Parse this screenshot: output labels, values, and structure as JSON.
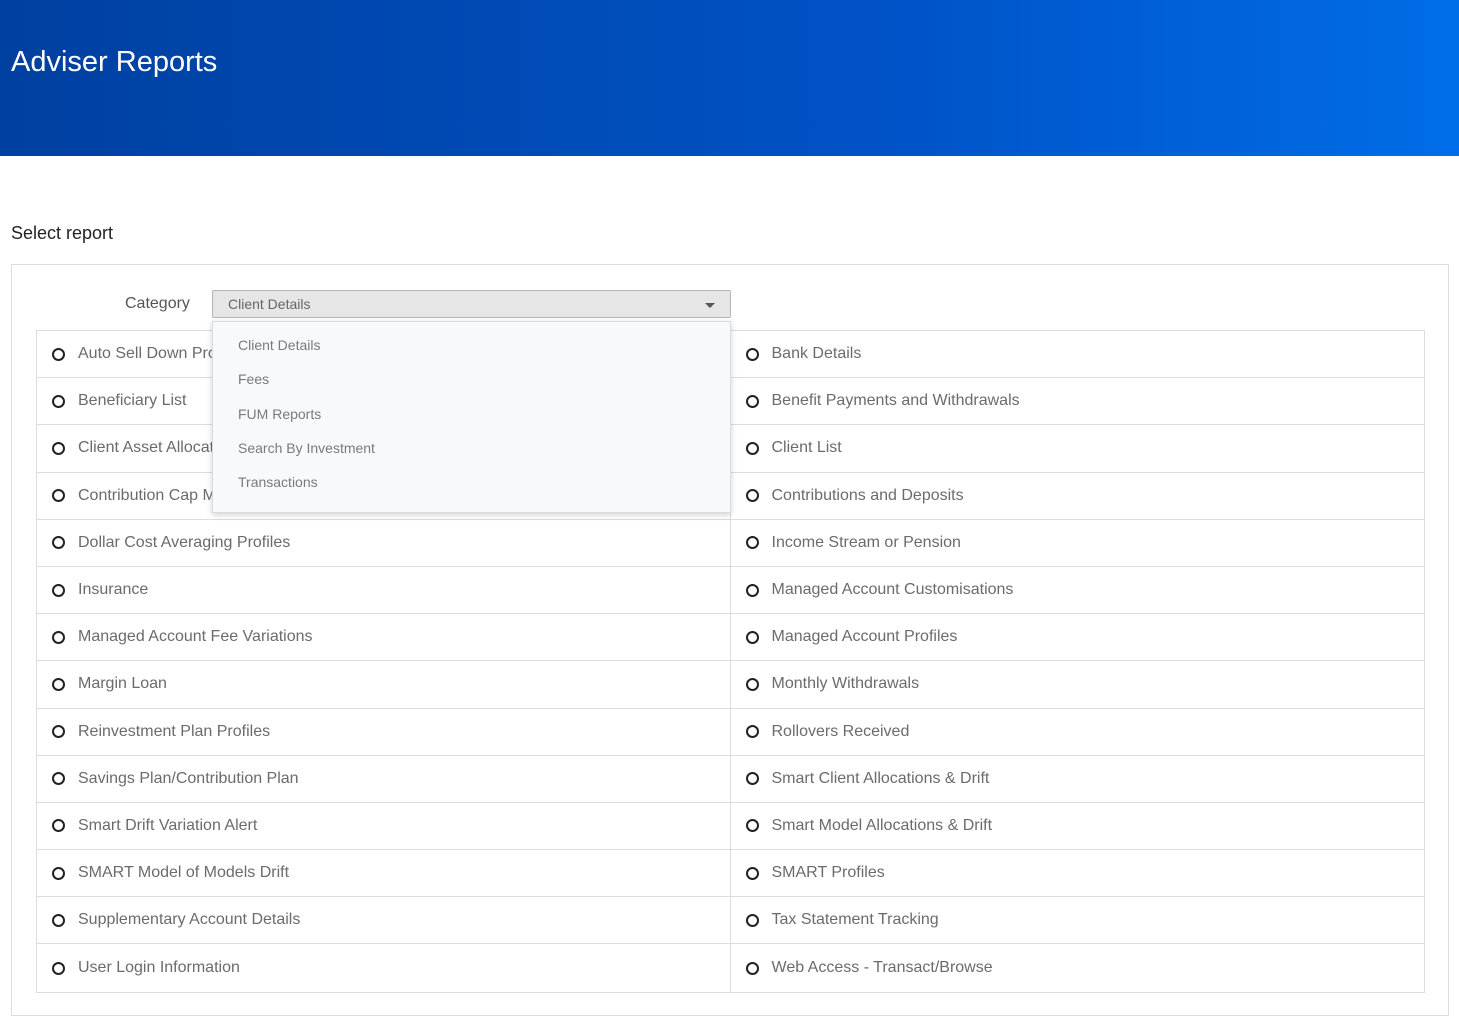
{
  "header": {
    "title": "Adviser Reports"
  },
  "select_report": {
    "label": "Select report"
  },
  "category": {
    "label": "Category",
    "selected": "Client Details",
    "options": [
      "Client Details",
      "Fees",
      "FUM Reports",
      "Search By Investment",
      "Transactions"
    ]
  },
  "reports": [
    [
      "Auto Sell Down Profiles",
      "Bank Details"
    ],
    [
      "Beneficiary List",
      "Benefit Payments and Withdrawals"
    ],
    [
      "Client Asset Allocation",
      "Client List"
    ],
    [
      "Contribution Cap Monitoring",
      "Contributions and Deposits"
    ],
    [
      "Dollar Cost Averaging Profiles",
      "Income Stream or Pension"
    ],
    [
      "Insurance",
      "Managed Account Customisations"
    ],
    [
      "Managed Account Fee Variations",
      "Managed Account Profiles"
    ],
    [
      "Margin Loan",
      "Monthly Withdrawals"
    ],
    [
      "Reinvestment Plan Profiles",
      "Rollovers Received"
    ],
    [
      "Savings Plan/Contribution Plan",
      "Smart Client Allocations & Drift"
    ],
    [
      "Smart Drift Variation Alert",
      "Smart Model Allocations & Drift"
    ],
    [
      "SMART Model of Models Drift",
      "SMART Profiles"
    ],
    [
      "Supplementary Account Details",
      "Tax Statement Tracking"
    ],
    [
      "User Login Information",
      "Web Access - Transact/Browse"
    ]
  ],
  "colors": {
    "header_gradient_start": "#0040a0",
    "header_gradient_end": "#006de8"
  }
}
